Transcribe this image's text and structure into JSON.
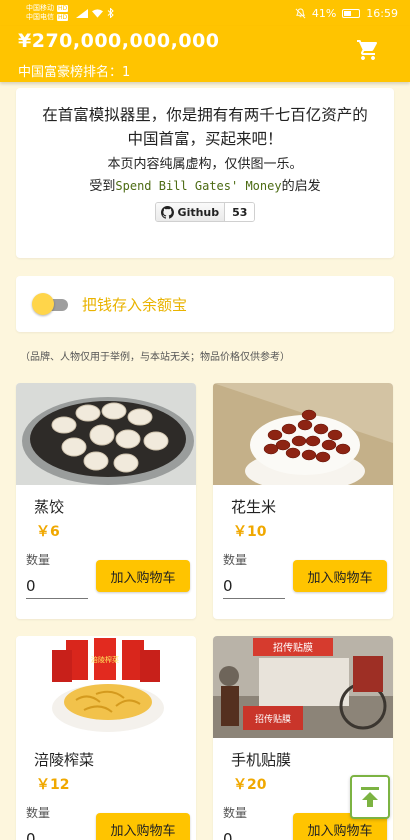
{
  "status_bar": {
    "carrier1": "中国移动",
    "carrier2": "中国电信",
    "hd": "HD",
    "battery": "41%",
    "time": "16:59"
  },
  "header": {
    "balance": "¥270,000,000,000",
    "rank_label": "中国富豪榜排名：",
    "rank_value": "1",
    "cart_icon": "cart-icon",
    "accent_color": "#ffc400"
  },
  "intro": {
    "line1": "在首富模拟器里，你是拥有有两千七百亿资产的",
    "line2": "中国首富，买起来吧！",
    "line3": "本页内容纯属虚构，仅供图一乐。",
    "line4_prefix": "受到",
    "line4_link": "Spend Bill Gates' Money",
    "line4_suffix": "的启发",
    "github_label": "Github",
    "github_count": "53"
  },
  "toggle": {
    "label": "把钱存入余额宝",
    "checked": false
  },
  "disclaimer": "（品牌、人物仅用于举例，与本站无关；物品价格仅供参考）",
  "products": [
    {
      "name": "蒸饺",
      "price": "￥6",
      "qty_label": "数量",
      "qty": "0",
      "button": "加入购物车"
    },
    {
      "name": "花生米",
      "price": "￥10",
      "qty_label": "数量",
      "qty": "0",
      "button": "加入购物车"
    },
    {
      "name": "涪陵榨菜",
      "price": "￥12",
      "qty_label": "数量",
      "qty": "0",
      "button": "加入购物车"
    },
    {
      "name": "手机贴膜",
      "price": "￥20",
      "qty_label": "数量",
      "qty": "0",
      "button": "加入购物车"
    }
  ],
  "product_photo_signs": {
    "pickle_pack": "涪陵榨菜",
    "film_stall_top": "招传贴膜",
    "film_stall_side": "招传贴膜"
  }
}
